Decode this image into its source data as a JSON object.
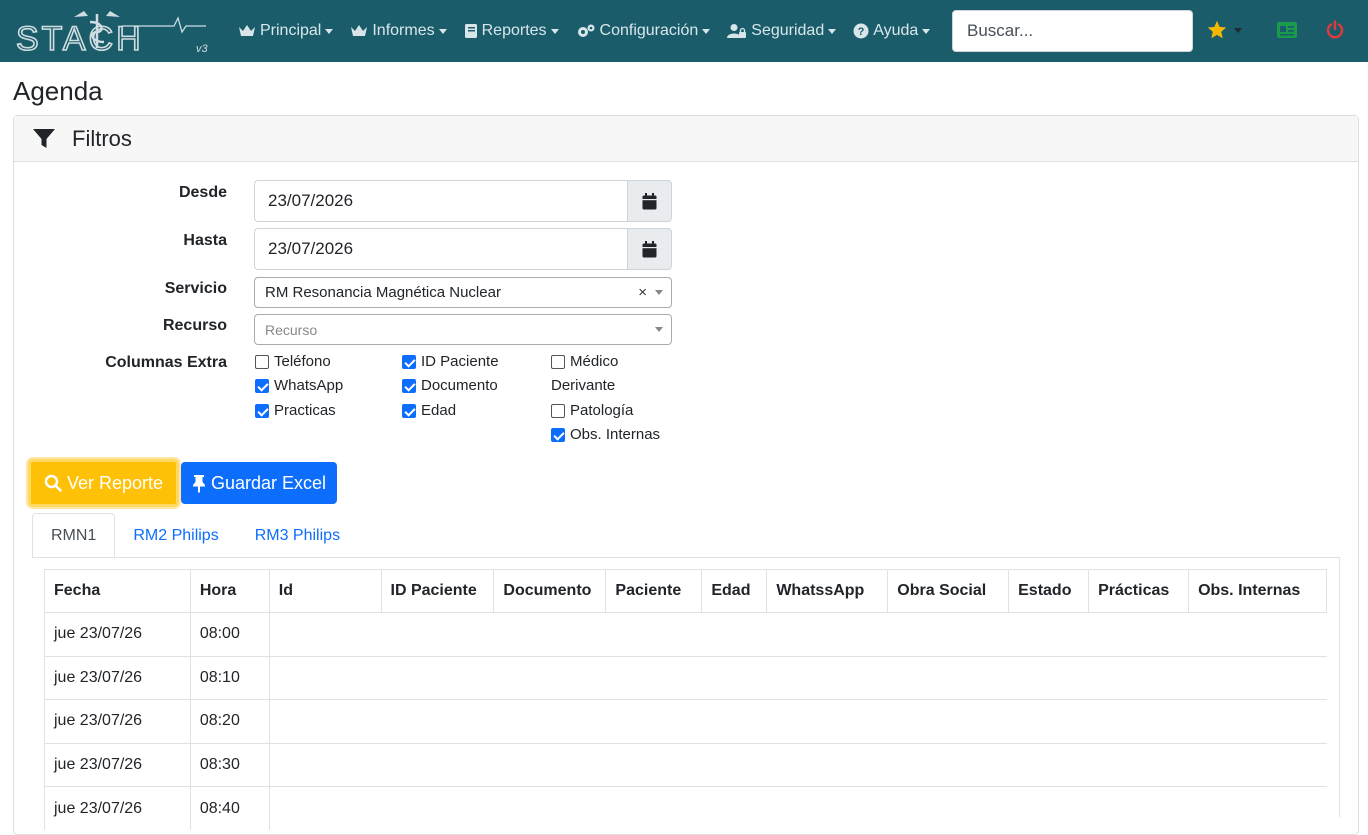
{
  "navbar": {
    "logo_text": "STACH",
    "logo_version": "v3",
    "menu": [
      {
        "label": "Principal",
        "icon": "crown-icon"
      },
      {
        "label": "Informes",
        "icon": "crown-icon"
      },
      {
        "label": "Reportes",
        "icon": "book-icon"
      },
      {
        "label": "Configuración",
        "icon": "gears-icon"
      },
      {
        "label": "Seguridad",
        "icon": "user-lock-icon"
      },
      {
        "label": "Ayuda",
        "icon": "question-circle-icon"
      }
    ],
    "search_placeholder": "Buscar...",
    "colors": {
      "bar": "#1b5c6b",
      "star": "#f5b800",
      "card": "#1a9b4b",
      "power": "#e0393e"
    }
  },
  "page": {
    "title": "Agenda"
  },
  "filters": {
    "title": "Filtros",
    "desde_label": "Desde",
    "desde_value": "23/07/2026",
    "hasta_label": "Hasta",
    "hasta_value": "23/07/2026",
    "servicio_label": "Servicio",
    "servicio_value": "RM Resonancia Magnética Nuclear",
    "recurso_label": "Recurso",
    "recurso_placeholder": "Recurso",
    "columnas_label": "Columnas Extra",
    "checkboxes": [
      {
        "label": "Teléfono",
        "checked": false
      },
      {
        "label": "WhatsApp",
        "checked": true
      },
      {
        "label": "Practicas",
        "checked": true
      },
      {
        "label": "ID Paciente",
        "checked": true
      },
      {
        "label": "Documento",
        "checked": true
      },
      {
        "label": "Edad",
        "checked": true
      },
      {
        "label": "Médico",
        "label2": "Derivante",
        "checked": false
      },
      {
        "label": "Patología",
        "checked": false
      },
      {
        "label": "Obs. Internas",
        "checked": true
      }
    ]
  },
  "buttons": {
    "ver_reporte": "Ver Reporte",
    "guardar_excel": "Guardar Excel"
  },
  "tabs": [
    "RMN1",
    "RM2 Philips",
    "RM3 Philips"
  ],
  "table": {
    "headers": [
      "Fecha",
      "Hora",
      "Id",
      "ID Paciente",
      "Documento",
      "Paciente",
      "Edad",
      "WhatssApp",
      "Obra Social",
      "Estado",
      "Prácticas",
      "Obs. Internas"
    ],
    "rows": [
      {
        "fecha": "jue 23/07/26",
        "hora": "08:00"
      },
      {
        "fecha": "jue 23/07/26",
        "hora": "08:10"
      },
      {
        "fecha": "jue 23/07/26",
        "hora": "08:20"
      },
      {
        "fecha": "jue 23/07/26",
        "hora": "08:30"
      },
      {
        "fecha": "jue 23/07/26",
        "hora": "08:40"
      }
    ]
  }
}
